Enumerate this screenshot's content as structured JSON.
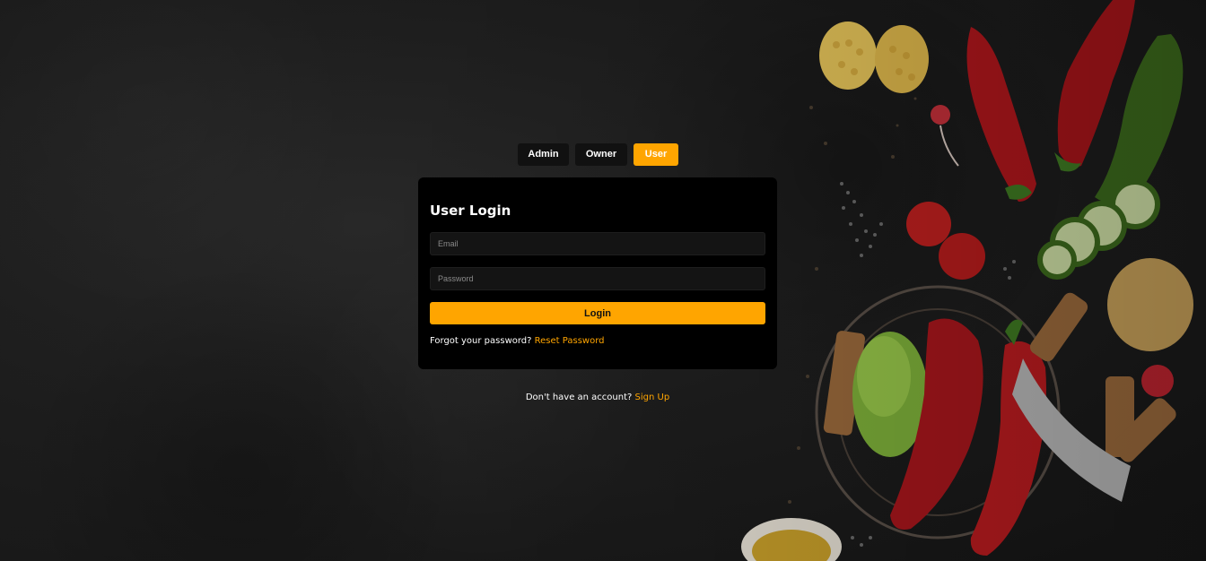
{
  "role_tabs": {
    "admin": "Admin",
    "owner": "Owner",
    "user": "User",
    "active": "User"
  },
  "login_card": {
    "title": "User Login",
    "email_placeholder": "Email",
    "password_placeholder": "Password",
    "login_label": "Login",
    "forgot_text": "Forgot your password?",
    "reset_link": "Reset Password"
  },
  "signup": {
    "text": "Don't have an account?",
    "link": "Sign Up"
  },
  "colors": {
    "accent": "#ffa500",
    "card": "#000000",
    "background": "#1f1f1f"
  },
  "background_image": "vegetables-on-dark-slate"
}
